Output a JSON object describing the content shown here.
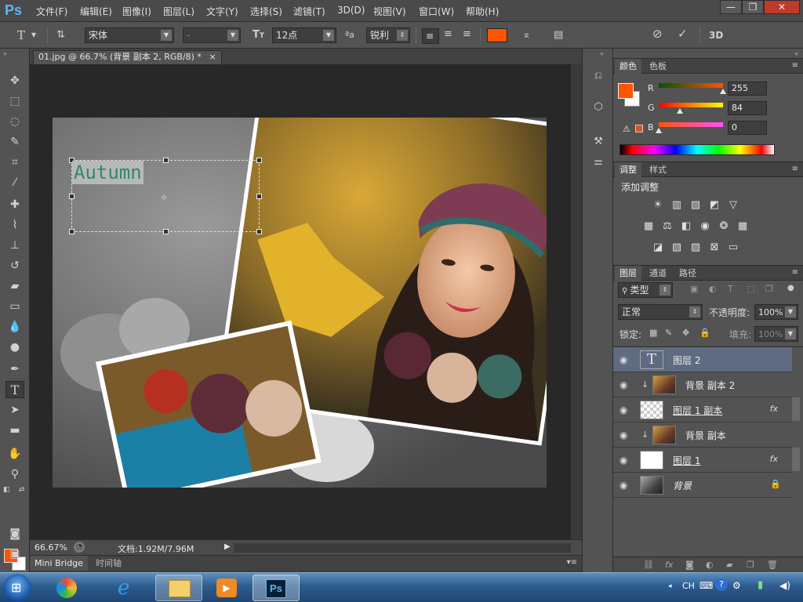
{
  "app": {
    "logo": "Ps",
    "menu": [
      "文件(F)",
      "编辑(E)",
      "图像(I)",
      "图层(L)",
      "文字(Y)",
      "选择(S)",
      "滤镜(T)",
      "3D(D)",
      "视图(V)",
      "窗口(W)",
      "帮助(H)"
    ],
    "window_controls": [
      "—",
      "❐",
      "✕"
    ]
  },
  "options_bar": {
    "tool_glyph": "T",
    "font_family": "宋体",
    "font_style": "-",
    "font_size": "12点",
    "aa_label": "ªa",
    "antialias": "锐利",
    "text_color": "#ff5400",
    "three_d_label": "3D"
  },
  "document": {
    "tab_title": "01.jpg @ 66.7% (背景 副本 2, RGB/8) *",
    "tab_close": "×",
    "text_layer_content": "Autumn",
    "zoom": "66.67%",
    "doc_size": "文档:1.92M/7.96M"
  },
  "bottom_tabs": [
    "Mini Bridge",
    "时间轴"
  ],
  "color_panel": {
    "tabs": [
      "颜色",
      "色板"
    ],
    "foreground": "#ff5400",
    "background": "#ffffff",
    "r_label": "R",
    "g_label": "G",
    "b_label": "B",
    "r": "255",
    "g": "84",
    "b": "0",
    "r_level": 1.0,
    "g_level": 0.33,
    "b_level": 0.0
  },
  "adjustments_panel": {
    "tabs": [
      "调整",
      "样式"
    ],
    "title": "添加调整"
  },
  "layers_panel": {
    "tabs": [
      "图层",
      "通道",
      "路径"
    ],
    "filter_kind": "类型",
    "blend_mode": "正常",
    "opacity_label": "不透明度:",
    "opacity": "100%",
    "lock_label": "锁定:",
    "fill_label": "填充:",
    "fill": "100%",
    "layers": [
      {
        "name": "图层 2",
        "type": "text",
        "selected": true,
        "fx": false,
        "clipped": false,
        "locked": false
      },
      {
        "name": "背景 副本 2",
        "type": "photo",
        "selected": false,
        "fx": false,
        "clipped": true,
        "locked": false
      },
      {
        "name": "图层 1 副本",
        "type": "transparent",
        "selected": false,
        "fx": true,
        "clipped": false,
        "locked": false
      },
      {
        "name": "背景 副本",
        "type": "photo",
        "selected": false,
        "fx": false,
        "clipped": true,
        "locked": false
      },
      {
        "name": "图层 1",
        "type": "white",
        "selected": false,
        "fx": true,
        "clipped": false,
        "locked": false
      },
      {
        "name": "背景",
        "type": "photo-bw",
        "selected": false,
        "fx": false,
        "clipped": false,
        "locked": true
      }
    ],
    "fx_label": "fx"
  },
  "taskbar": {
    "lang": "CH"
  }
}
